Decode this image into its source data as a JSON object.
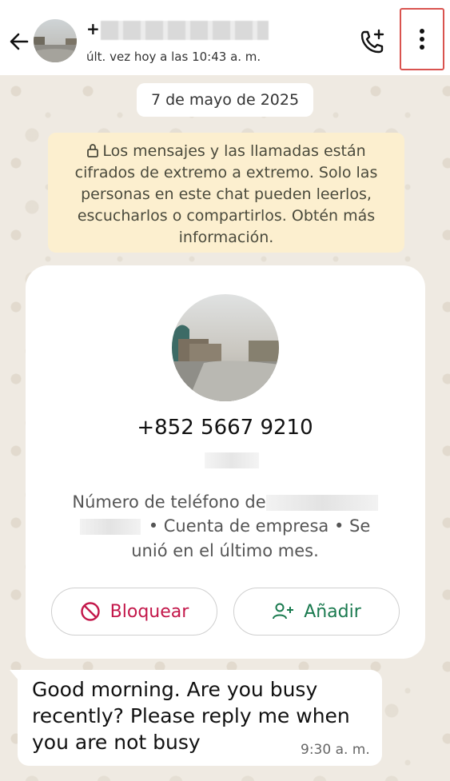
{
  "header": {
    "contact_prefix": "+",
    "last_seen": "últ. vez hoy a las 10:43 a. m.",
    "icons": {
      "back": "arrow-left-icon",
      "call": "add-call-icon",
      "menu": "more-vertical-icon"
    }
  },
  "chat": {
    "date_chip": "7 de mayo de 2025",
    "encryption_notice": "Los mensajes y las llamadas están cifrados de extremo a extremo. Solo las personas en este chat pueden leerlos, escucharlos o compartirlos. Obtén más información."
  },
  "contact_card": {
    "phone": "+852 5667 9210",
    "info_line1": "Número de teléfono de",
    "info_line2_a": "•  Cuenta de empresa  •  Se",
    "info_line3": "unió en el último mes.",
    "block_label": "Bloquear",
    "add_label": "Añadir"
  },
  "messages": [
    {
      "text": "Good morning. Are you busy recently? Please reply me when you are not busy",
      "time": "9:30 a. m."
    }
  ],
  "colors": {
    "block": "#c3174a",
    "add": "#1a7a4f",
    "notice_bg": "#fcefcf",
    "highlight": "#d9534f"
  }
}
